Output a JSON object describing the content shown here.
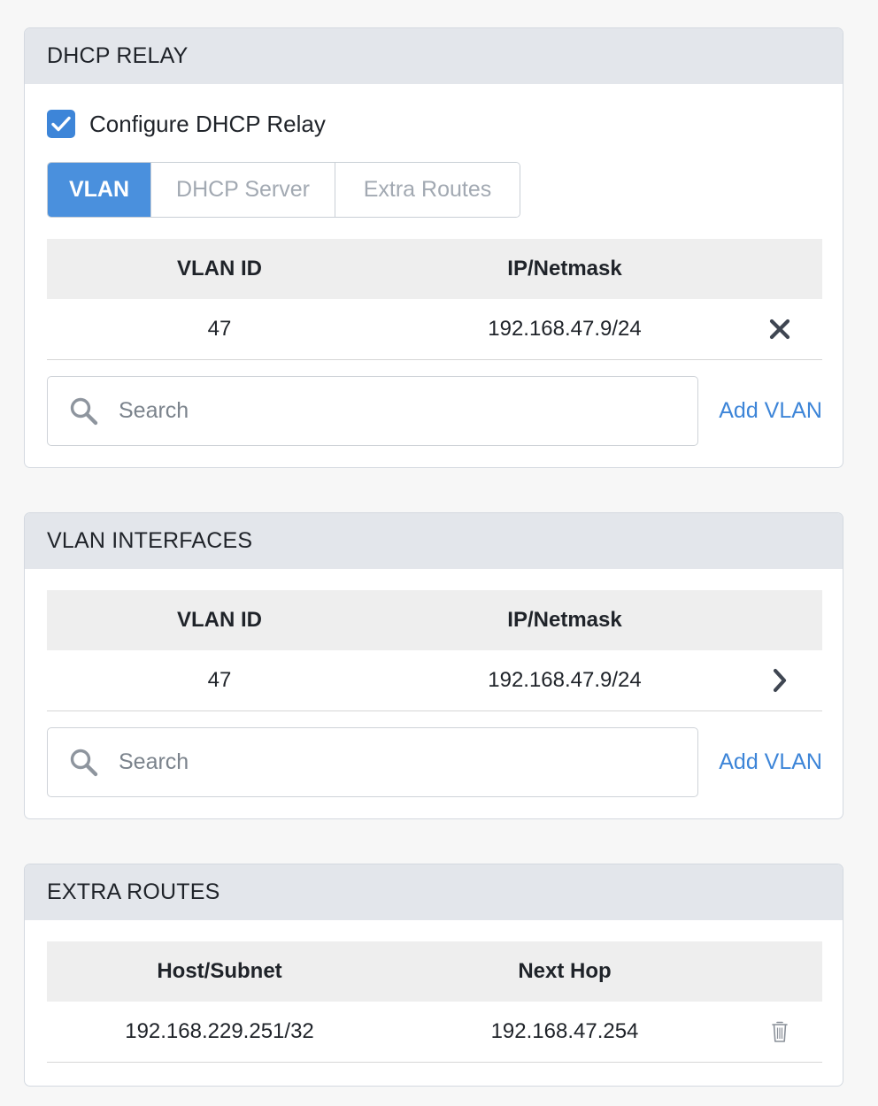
{
  "dhcp_relay": {
    "title": "DHCP RELAY",
    "checkbox_label": "Configure DHCP Relay",
    "checked": true,
    "tabs": [
      {
        "label": "VLAN",
        "active": true
      },
      {
        "label": "DHCP Server",
        "active": false
      },
      {
        "label": "Extra Routes",
        "active": false
      }
    ],
    "table": {
      "headers": [
        "VLAN ID",
        "IP/Netmask"
      ],
      "rows": [
        {
          "vlan_id": "47",
          "ip": "192.168.47.9/24",
          "action_icon": "close-icon"
        }
      ]
    },
    "search_placeholder": "Search",
    "add_label": "Add VLAN"
  },
  "vlan_interfaces": {
    "title": "VLAN INTERFACES",
    "table": {
      "headers": [
        "VLAN ID",
        "IP/Netmask"
      ],
      "rows": [
        {
          "vlan_id": "47",
          "ip": "192.168.47.9/24",
          "action_icon": "chevron-right-icon"
        }
      ]
    },
    "search_placeholder": "Search",
    "add_label": "Add VLAN"
  },
  "extra_routes": {
    "title": "EXTRA ROUTES",
    "table": {
      "headers": [
        "Host/Subnet",
        "Next Hop"
      ],
      "rows": [
        {
          "host": "192.168.229.251/32",
          "next_hop": "192.168.47.254",
          "action_icon": "trash-icon"
        }
      ]
    }
  },
  "colors": {
    "accent": "#4a90dd",
    "link": "#3d85d8",
    "header_bg": "#e3e6eb",
    "table_header_bg": "#eeeeee",
    "page_bg": "#f7f7f7"
  }
}
